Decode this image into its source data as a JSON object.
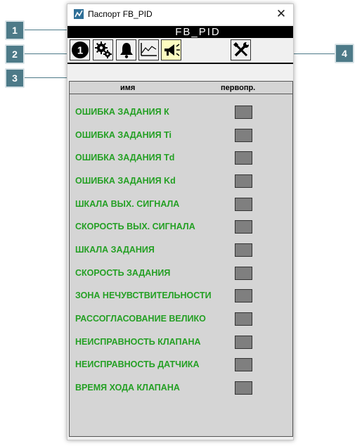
{
  "window": {
    "title": "Паспорт FB_PID",
    "close_glyph": "✕"
  },
  "header": {
    "title": "FB_PID"
  },
  "toolbar": {
    "buttons": [
      {
        "icon": "number-1-icon",
        "text": "1"
      },
      {
        "icon": "gears-icon"
      },
      {
        "icon": "bell-icon"
      },
      {
        "icon": "trend-chart-icon"
      },
      {
        "icon": "megaphone-icon",
        "active": true
      },
      {
        "icon": "tools-icon"
      }
    ]
  },
  "table": {
    "col_name": "имя",
    "col_first": "первопр.",
    "rows": [
      "ОШИБКА ЗАДАНИЯ К",
      "ОШИБКА ЗАДАНИЯ Ti",
      "ОШИБКА ЗАДАНИЯ Td",
      "ОШИБКА ЗАДАНИЯ Kd",
      "ШКАЛА ВЫХ. СИГНАЛА",
      "СКОРОСТЬ ВЫХ. СИГНАЛА",
      "ШКАЛА ЗАДАНИЯ",
      "СКОРОСТЬ ЗАДАНИЯ",
      "ЗОНА НЕЧУВСТВИТЕЛЬНОСТИ",
      "РАССОГЛАСОВАНИЕ ВЕЛИКО",
      "НЕИСПРАВНОСТЬ КЛАПАНА",
      "НЕИСПРАВНОСТЬ ДАТЧИКА",
      "ВРЕМЯ ХОДА КЛАПАНА"
    ]
  },
  "callouts": [
    "1",
    "2",
    "3",
    "4"
  ],
  "colors": {
    "callout": "#4d7a88",
    "row_text": "#24a024",
    "indicator": "#7f7f7f",
    "active_button": "#fdfcc0"
  }
}
